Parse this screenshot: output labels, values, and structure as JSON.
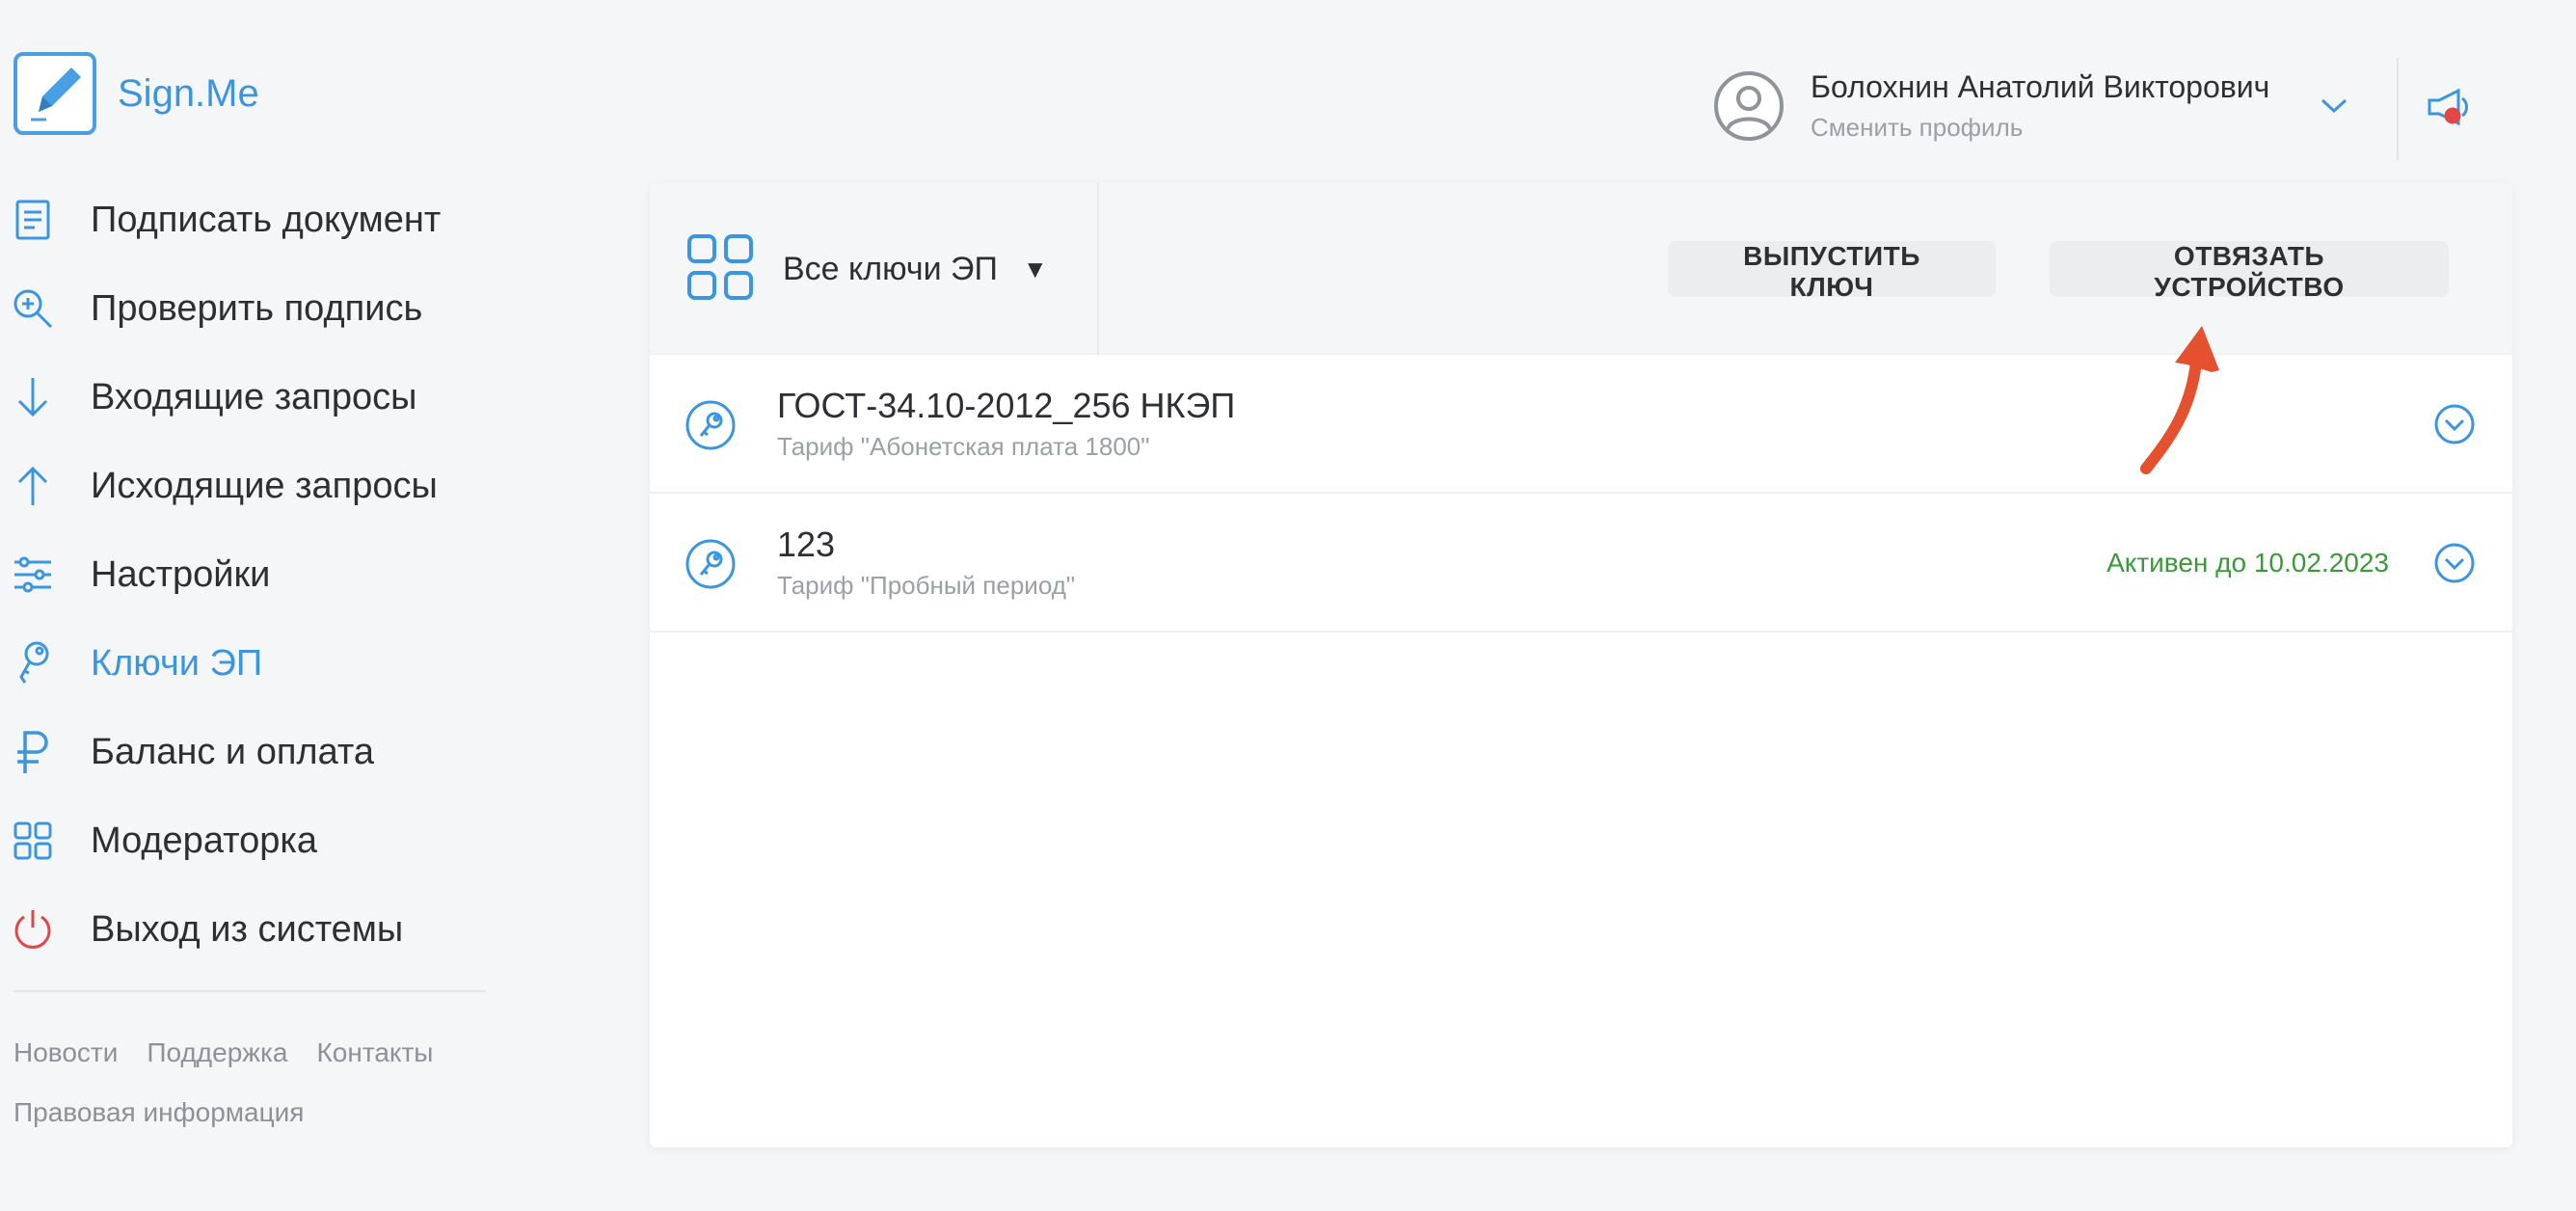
{
  "app": {
    "name": "Sign.Me"
  },
  "sidebar": {
    "items": [
      {
        "label": "Подписать документ",
        "icon": "document-icon",
        "active": false
      },
      {
        "label": "Проверить подпись",
        "icon": "search-zoom-icon",
        "active": false
      },
      {
        "label": "Входящие запросы",
        "icon": "arrow-down-icon",
        "active": false
      },
      {
        "label": "Исходящие запросы",
        "icon": "arrow-up-icon",
        "active": false
      },
      {
        "label": "Настройки",
        "icon": "sliders-icon",
        "active": false
      },
      {
        "label": "Ключи ЭП",
        "icon": "key-icon",
        "active": true
      },
      {
        "label": "Баланс и оплата",
        "icon": "ruble-icon",
        "active": false
      },
      {
        "label": "Модераторка",
        "icon": "grid-icon",
        "active": false
      },
      {
        "label": "Выход из системы",
        "icon": "power-icon",
        "active": false
      }
    ],
    "footer": {
      "news": "Новости",
      "support": "Поддержка",
      "contacts": "Контакты",
      "legal": "Правовая информация"
    }
  },
  "header": {
    "user_name": "Болохнин Анатолий Викторович",
    "switch_profile": "Сменить профиль"
  },
  "toolbar": {
    "filter_label": "Все ключи ЭП",
    "filter_caret": "▼",
    "issue_key": "ВЫПУСТИТЬ КЛЮЧ",
    "unbind_device": "ОТВЯЗАТЬ УСТРОЙСТВО"
  },
  "keys": [
    {
      "title": "ГОСТ-34.10-2012_256 НКЭП",
      "tariff": "Тариф \"Абонетская плата 1800\"",
      "status": ""
    },
    {
      "title": "123",
      "tariff": "Тариф \"Пробный период\"",
      "status": "Активен до 10.02.2023"
    }
  ],
  "colors": {
    "accent": "#3c96df",
    "status_active": "#3a9a3a",
    "annotation_arrow": "#e5512f",
    "logout": "#e04848"
  }
}
